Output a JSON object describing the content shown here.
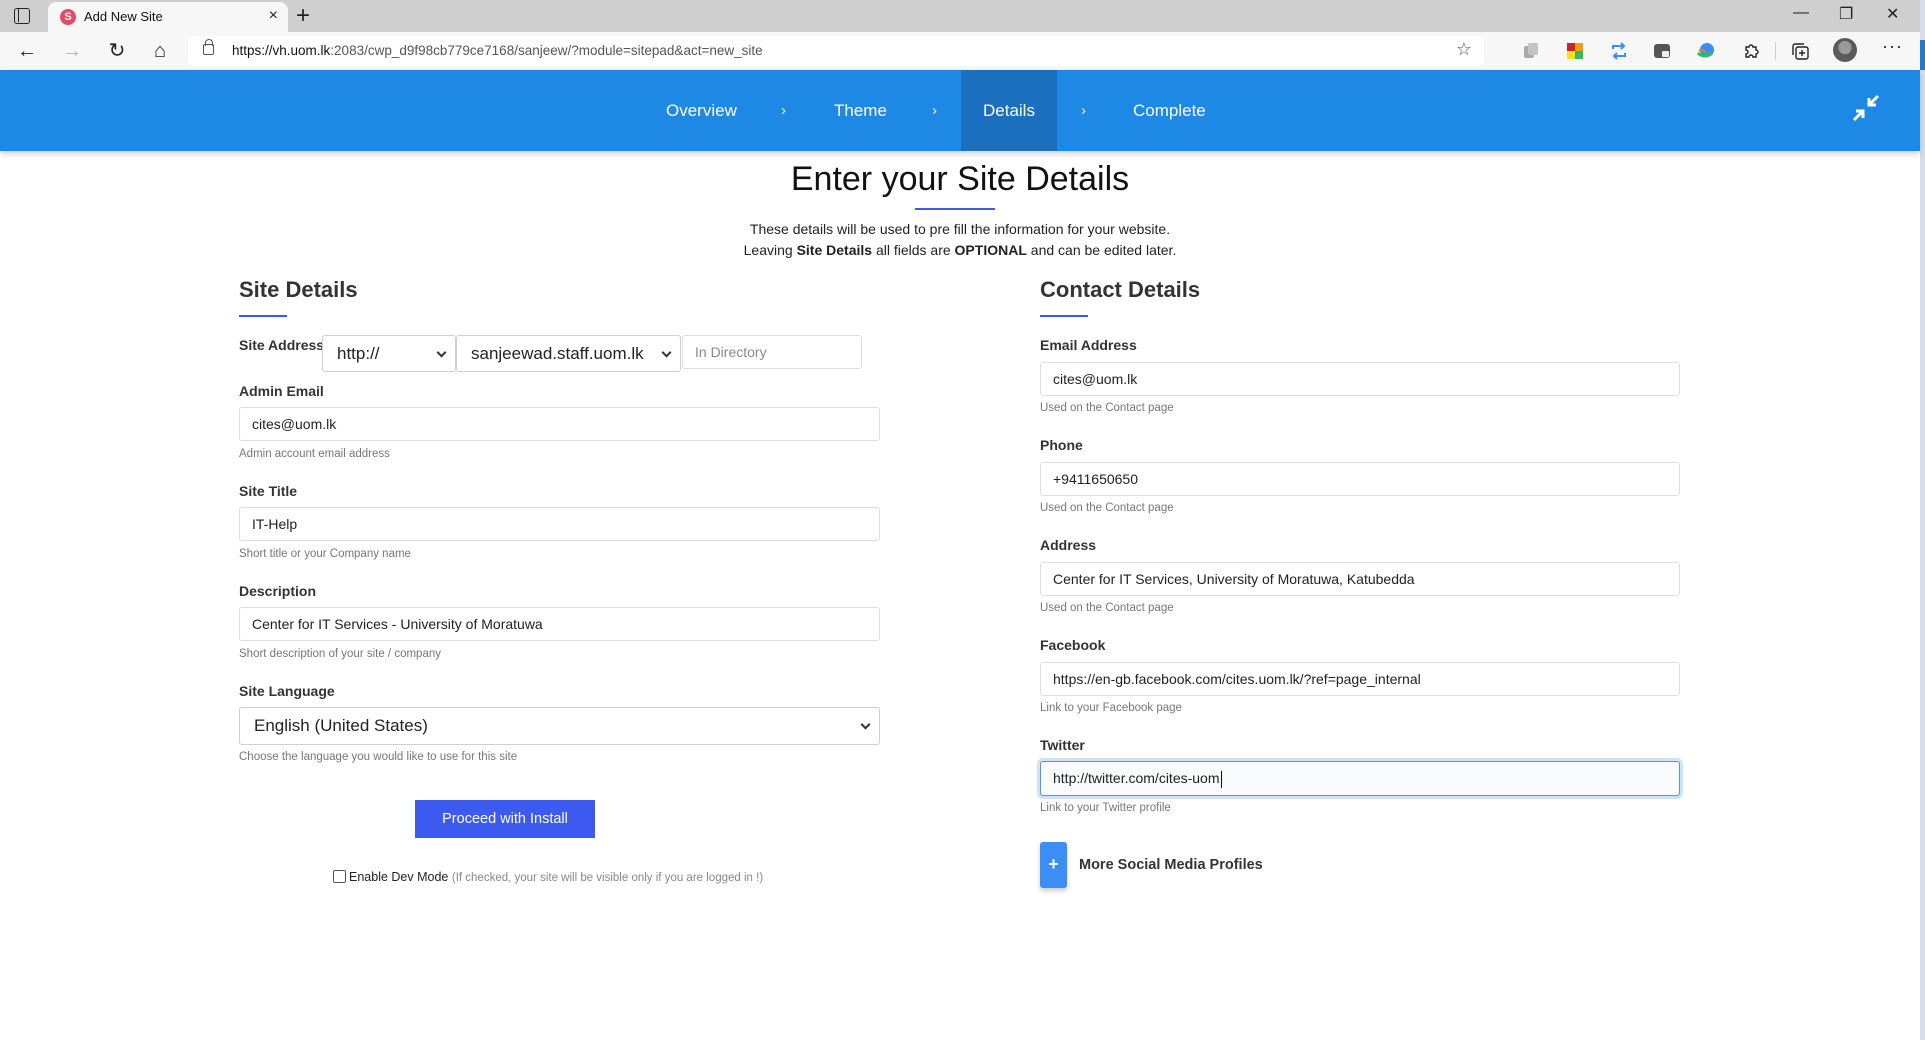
{
  "browser": {
    "tab_title": "Add New Site",
    "tab_favicon": "S",
    "url_host": "https://vh.uom.lk",
    "url_rest": ":2083/cwp_d9f98cb779ce7168/sanjeew/?module=sitepad&act=new_site",
    "icons": {
      "tab_actions": "tab-actions-icon",
      "close_tab": "×",
      "new_tab": "+",
      "back": "←",
      "forward": "→",
      "refresh": "↻",
      "home": "⌂",
      "favorite": "☆",
      "minimize": "—",
      "restore": "❐",
      "close_window": "✕",
      "more": "···"
    }
  },
  "wizard": {
    "steps": [
      {
        "label": "Overview",
        "active": false
      },
      {
        "label": "Theme",
        "active": false
      },
      {
        "label": "Details",
        "active": true
      },
      {
        "label": "Complete",
        "active": false
      }
    ],
    "separator": "›"
  },
  "header": {
    "title": "Enter your Site Details",
    "line1": "These details will be used to pre fill the information for your website.",
    "line2_prefix": "Leaving ",
    "line2_bold1": "Site Details",
    "line2_mid": " all fields are ",
    "line2_bold2": "OPTIONAL",
    "line2_suffix": " and can be edited later."
  },
  "site_details": {
    "title": "Site Details",
    "site_address": {
      "label": "Site Address",
      "protocol": "http://",
      "domain": "sanjeewad.staff.uom.lk",
      "directory_placeholder": "In Directory"
    },
    "admin_email": {
      "label": "Admin Email",
      "value": "cites@uom.lk",
      "help": "Admin account email address"
    },
    "site_title": {
      "label": "Site Title",
      "value": "IT-Help",
      "help": "Short title or your Company name"
    },
    "description": {
      "label": "Description",
      "value": "Center for IT Services - University of Moratuwa",
      "help": "Short description of your site / company"
    },
    "site_language": {
      "label": "Site Language",
      "value": "English (United States)",
      "help": "Choose the language you would like to use for this site"
    },
    "proceed_button": "Proceed with Install",
    "dev_mode": {
      "label": "Enable Dev Mode",
      "note": "(If checked, your site will be visible only if you are logged in !)",
      "checked": false
    }
  },
  "contact_details": {
    "title": "Contact Details",
    "email": {
      "label": "Email Address",
      "value": "cites@uom.lk",
      "help": "Used on the Contact page"
    },
    "phone": {
      "label": "Phone",
      "value": "+9411650650",
      "help": "Used on the Contact page"
    },
    "address": {
      "label": "Address",
      "value": "Center for IT Services, University of Moratuwa, Katubedda",
      "help": "Used on the Contact page"
    },
    "facebook": {
      "label": "Facebook",
      "value": "https://en-gb.facebook.com/cites.uom.lk/?ref=page_internal",
      "help": "Link to your Facebook page"
    },
    "twitter": {
      "label": "Twitter",
      "value": "http://twitter.com/cites-uom",
      "help": "Link to your Twitter profile"
    },
    "more_social_button": "+",
    "more_social_label": "More Social Media Profiles"
  },
  "colors": {
    "nav_bg": "#1e88e5",
    "nav_active": "#1a6fbf",
    "accent": "#3c5af0",
    "plus_button": "#3a8ef6"
  }
}
